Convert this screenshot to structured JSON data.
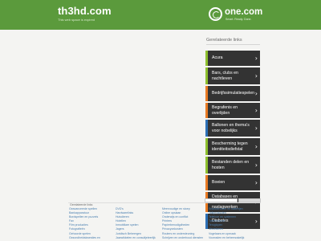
{
  "header": {
    "domain": "th3hd.com",
    "tagline": "This web space is expired",
    "logo_text": "one.com",
    "logo_tagline": "Smart. Ready. Done."
  },
  "related": {
    "title": "Gerelateerde links",
    "items": [
      {
        "label": "Acura",
        "accent": "#8dbf2e"
      },
      {
        "label": "Bars, clubs en nachtleven",
        "accent": "#8dbf2e"
      },
      {
        "label": "Bedrijfssimulatiespelen",
        "accent": "#e87a24"
      },
      {
        "label": "Begrafenis en overlijden",
        "accent": "#e87a24"
      },
      {
        "label": "Ballonen en thema's voor nobelijks",
        "accent": "#2c6fb5"
      },
      {
        "label": "Bescherming tegen identiteitsdiefstal",
        "accent": "#8dbf2e"
      },
      {
        "label": "Bestanden delen en hosten",
        "accent": "#8dbf2e"
      },
      {
        "label": "Boeien",
        "accent": "#e87a24"
      },
      {
        "label": "Databases en elektronische naslagwerken",
        "accent": "#e87a24"
      },
      {
        "label": "Diabetes",
        "accent": "#2c6fb5"
      }
    ]
  },
  "footer": {
    "title": "Gerelateerde links",
    "columns": [
      [
        "Geavanceerde spellen",
        "Bankapparatuur",
        "Bordspellen en puzzels",
        "Fax",
        "Film producties",
        "Fotografieën",
        "Gehoorde spelen",
        "Gezondheidskwesties en"
      ],
      [
        "DVD's",
        "Hardwarelinks",
        "Huisdieren",
        "Hotellen",
        "Inmobiliare spelen",
        "Jagers",
        "Juridisch Beheergen",
        "Jaarwikkelen en consultjeleerlijk"
      ],
      [
        "Meervoudige en stoep",
        "Online opslaan",
        "Onderwijs en conflict",
        "Printers",
        "Papierbenodigdheden",
        "Privacyonkosten",
        "Routers en ondersteuning",
        "Schrijven en onderhoud diensten"
      ],
      [
        "Snackbeurzen en batterijen",
        "Talkproducten",
        "Telefoon en systemen",
        "Tweetsnicher",
        "Teruglopen",
        "Verzekeren",
        "Vogelaars en opmaak",
        "Voorraden en beheerzakelijk"
      ]
    ]
  },
  "colors": {
    "header_green": "#5b9a3c",
    "link_bg": "#333333",
    "footer_link": "#4a7fb0"
  }
}
